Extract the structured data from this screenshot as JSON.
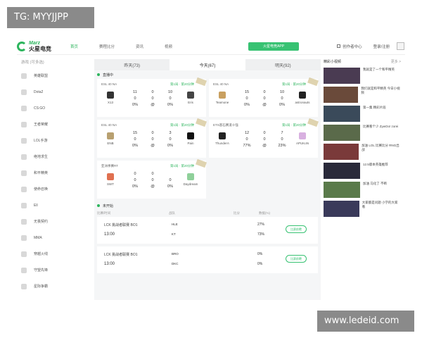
{
  "watermarks": {
    "top_left": "TG: MYYJJPP",
    "bottom_right": "www.ledeid.com"
  },
  "header": {
    "logo_en": "Marz",
    "logo_cn": "火星电竞",
    "nav": [
      "首页",
      "赛程比分",
      "资讯",
      "视频"
    ],
    "download_label": "火星电竞APP",
    "creator_label": "创作者中心",
    "login_label": "登录/注册"
  },
  "sidebar": {
    "title": "游戏 (可多选)",
    "items": [
      "英雄联盟",
      "Dota2",
      "CS:GO",
      "王者荣耀",
      "LOL手游",
      "绝地求生",
      "和平精英",
      "使命召唤",
      "Ell",
      "无畏契约",
      "MMA",
      "穿越火线",
      "守望先锋",
      "星际争霸"
    ]
  },
  "tabs": [
    "昨天(73)",
    "今天(67)",
    "明天(92)"
  ],
  "live_label": "直播中",
  "live_matches": [
    {
      "league": "ESL 40 NA",
      "round": "第1局 · 第20分钟",
      "team1": "X13",
      "team2": "Eris",
      "s1": [
        "11",
        "0",
        "0%"
      ],
      "s2": [
        "10",
        "0",
        "0%"
      ],
      "mid": [
        "0",
        "0",
        "@"
      ],
      "c1": "#333",
      "c2": "#444"
    },
    {
      "league": "ESL 40 NA",
      "round": "第1局 · 第20分钟",
      "team1": "Teamone",
      "team2": "astronauts",
      "s1": [
        "15",
        "0",
        "0%"
      ],
      "s2": [
        "10",
        "0",
        "0%"
      ],
      "mid": [
        "0",
        "0",
        "@"
      ],
      "c1": "#c9a060",
      "c2": "#222"
    },
    {
      "league": "ESL 40 NA",
      "round": "第1局 · 第20分钟",
      "team1": "ENB",
      "team2": "Pain",
      "s1": [
        "15",
        "0",
        "0%"
      ],
      "s2": [
        "3",
        "0",
        "0%"
      ],
      "mid": [
        "0",
        "0",
        "@"
      ],
      "c1": "#b8a070",
      "c2": "#111"
    },
    {
      "league": "ETS基石赛道十强",
      "round": "第1局 · 第20分钟",
      "team1": "ThunderA",
      "team2": "APUKoN",
      "s1": [
        "12",
        "0",
        "77%"
      ],
      "s2": [
        "7",
        "0",
        "23%"
      ],
      "mid": [
        "0",
        "0",
        "@"
      ],
      "c1": "#222",
      "c2": "#d8b0e0"
    },
    {
      "league": "亚洲季赛RT",
      "round": "第1局 · 第20分钟",
      "team1": "SWT",
      "team2": "Daydream",
      "s1": [
        "0",
        "0",
        "0%"
      ],
      "s2": [
        "",
        "0",
        "0%"
      ],
      "mid": [
        "0",
        "0",
        "@"
      ],
      "c1": "#e07050",
      "c2": "#8fd09a"
    }
  ],
  "upcoming_label": "未开始",
  "upcoming_cols": [
    "比赛/时间",
    "战队",
    "比分",
    "数据(%)"
  ],
  "upcoming": [
    {
      "league": "LCK 挑战者联赛",
      "bo": "BO1",
      "time": "13:00",
      "t1": "HLE",
      "t2": "KT",
      "p1": "27%",
      "p2": "73%",
      "btn": "比赛前瞻"
    },
    {
      "league": "LCK 挑战者联赛",
      "bo": "BO1",
      "time": "13:00",
      "t1": "BRO",
      "t2": "DKC",
      "p1": "0%",
      "p2": "0%",
      "btn": "比赛前瞻"
    }
  ],
  "right": {
    "title": "精彩小视频",
    "more": "更多 >",
    "videos": [
      "我就是了一个和平精英",
      "我们就是和平精英 今日小视频",
      "第一集 精彩片段",
      "比赛看个少 ZywOo! zorei",
      "加油 LOL 比赛比分 RNG出战",
      "12.5版本英雄推荐",
      "加油 马化了 不断",
      "大家都是问题 小学的大家 看"
    ]
  }
}
